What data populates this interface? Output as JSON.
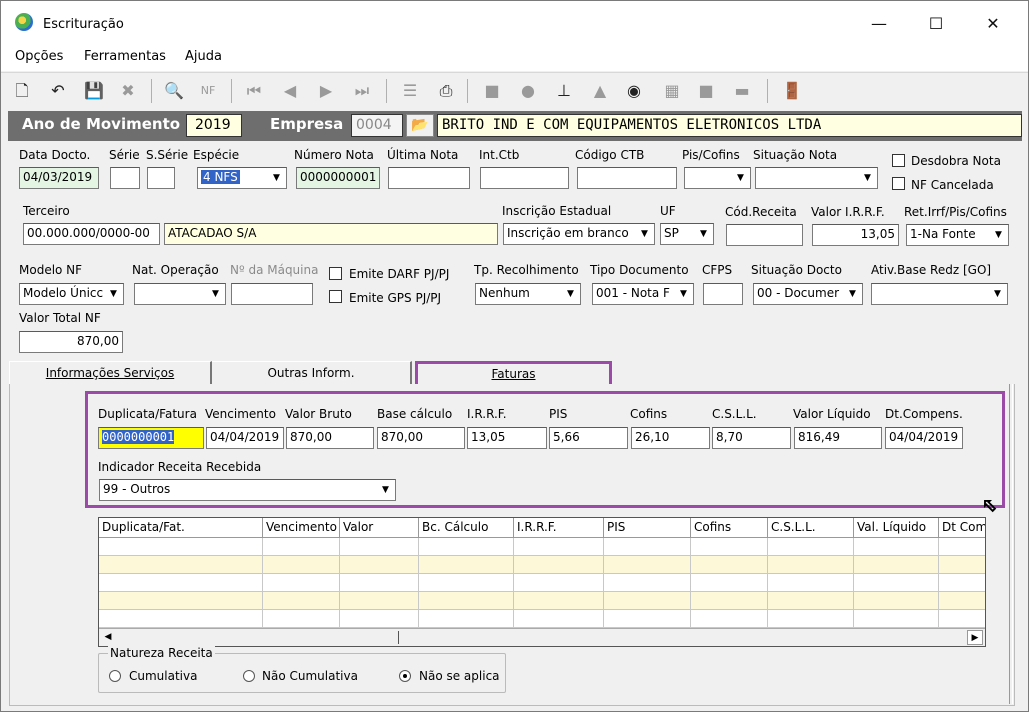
{
  "window": {
    "title": "Escrituração"
  },
  "menu": [
    "Opções",
    "Ferramentas",
    "Ajuda"
  ],
  "toolbar_icons": [
    "new-icon",
    "undo-icon",
    "save-icon",
    "delete-icon",
    "preview-icon",
    "nfe-icon",
    "first-icon",
    "prev-icon",
    "next-icon",
    "last-icon",
    "list-icon",
    "print-icon",
    "book-icon",
    "apple-icon",
    "stamp-icon",
    "tree-icon",
    "money-icon",
    "table-icon",
    "square-icon",
    "minus-icon",
    "exit-icon"
  ],
  "header": {
    "ano_label": "Ano de Movimento",
    "ano_value": "2019",
    "empresa_label": "Empresa",
    "empresa_code": "0004",
    "empresa_name": "BRITO IND E COM EQUIPAMENTOS ELETRONICOS LTDA"
  },
  "row1": {
    "data_docto_label": "Data Docto.",
    "data_docto": "04/03/2019",
    "serie_label": "Série",
    "sserie_label": "S.Série",
    "especie_label": "Espécie",
    "especie": "4 NFS",
    "numero_nota_label": "Número Nota",
    "numero_nota": "0000000001",
    "ultima_nota_label": "Última Nota",
    "int_ctb_label": "Int.Ctb",
    "codigo_ctb_label": "Código CTB",
    "pis_cofins_label": "Pis/Cofins",
    "situacao_nota_label": "Situação Nota",
    "desdobra_label": "Desdobra Nota",
    "nf_cancelada_label": "NF Cancelada"
  },
  "row2": {
    "terceiro_label": "Terceiro",
    "terceiro_cnpj": "00.000.000/0000-00",
    "terceiro_nome": "ATACADAO S/A",
    "inscricao_label": "Inscrição Estadual",
    "inscricao": "Inscrição em branco",
    "uf_label": "UF",
    "uf": "SP",
    "cod_receita_label": "Cód.Receita",
    "valor_irrf_label": "Valor I.R.R.F.",
    "valor_irrf": "13,05",
    "ret_label": "Ret.Irrf/Pis/Cofins",
    "ret": "1-Na Fonte"
  },
  "row3": {
    "modelo_label": "Modelo NF",
    "modelo": "Modelo Únicc",
    "nat_label": "Nat. Operação",
    "maquina_label": "Nº da Máquina",
    "darf_label": "Emite DARF PJ/PJ",
    "gps_label": "Emite GPS PJ/PJ",
    "tp_rec_label": "Tp. Recolhimento",
    "tp_rec": "Nenhum",
    "tipo_doc_label": "Tipo Documento",
    "tipo_doc": "001 - Nota F",
    "cfps_label": "CFPS",
    "sit_doc_label": "Situação Docto",
    "sit_doc": "00 - Documer",
    "ativ_label": "Ativ.Base Redz [GO]",
    "valor_total_label": "Valor Total NF",
    "valor_total": "870,00"
  },
  "tabs": [
    "Informações Serviços",
    "Outras Inform.",
    "Faturas"
  ],
  "faturas": {
    "labels": [
      "Duplicata/Fatura",
      "Vencimento",
      "Valor Bruto",
      "Base cálculo",
      "I.R.R.F.",
      "PIS",
      "Cofins",
      "C.S.L.L.",
      "Valor Líquido",
      "Dt.Compens."
    ],
    "values": [
      "0000000001",
      "04/04/2019",
      "870,00",
      "870,00",
      "13,05",
      "5,66",
      "26,10",
      "8,70",
      "816,49",
      "04/04/2019"
    ],
    "indicador_label": "Indicador Receita Recebida",
    "indicador": "99 - Outros"
  },
  "grid": {
    "columns": [
      "Duplicata/Fat.",
      "Vencimento",
      "Valor",
      "Bc. Cálculo",
      "I.R.R.F.",
      "PIS",
      "Cofins",
      "C.S.L.L.",
      "Val. Líquido",
      "Dt Com"
    ],
    "row_count": 5
  },
  "natureza": {
    "label": "Natureza Receita",
    "options": [
      "Cumulativa",
      "Não Cumulativa",
      "Não se aplica"
    ],
    "selected": "Não se aplica"
  },
  "colors": {
    "highlight": "#9b4aa8",
    "header_bg": "#6e6e6e",
    "input_yellow": "#ffffe1",
    "input_green": "#e4f5e4",
    "selection": "#3264c8"
  }
}
